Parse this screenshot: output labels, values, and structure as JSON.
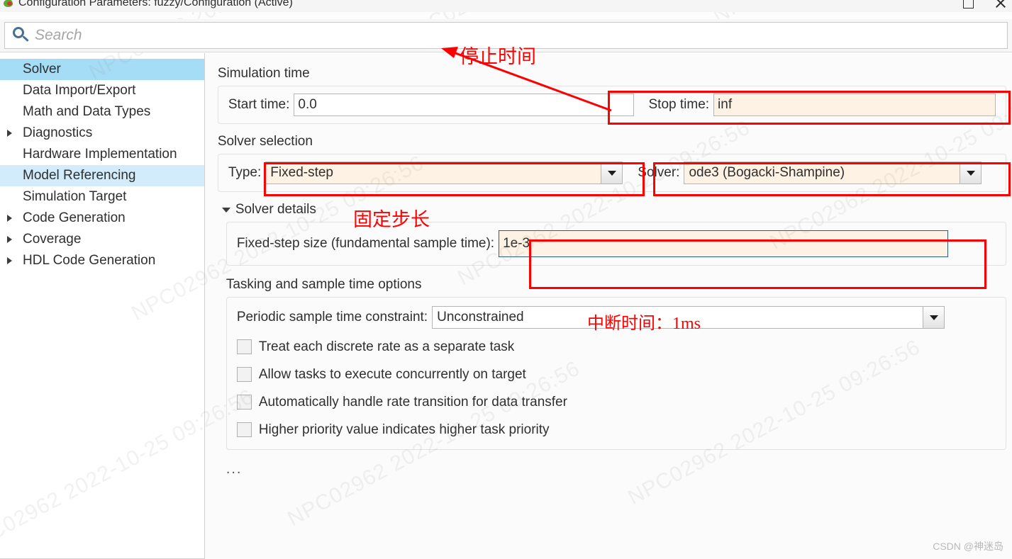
{
  "window": {
    "title": "Configuration Parameters: fuzzy/Configuration (Active)",
    "icon": "simulink-leaf-icon",
    "controls": {
      "maximize": "Maximize",
      "close": "Close"
    }
  },
  "search": {
    "placeholder": "Search",
    "value": "",
    "icon": "search-icon"
  },
  "sidebar": {
    "items": [
      {
        "label": "Solver",
        "expandable": false,
        "state": "selected"
      },
      {
        "label": "Data Import/Export",
        "expandable": false,
        "state": "normal"
      },
      {
        "label": "Math and Data Types",
        "expandable": false,
        "state": "normal"
      },
      {
        "label": "Diagnostics",
        "expandable": true,
        "state": "normal"
      },
      {
        "label": "Hardware Implementation",
        "expandable": false,
        "state": "normal"
      },
      {
        "label": "Model Referencing",
        "expandable": false,
        "state": "hovered"
      },
      {
        "label": "Simulation Target",
        "expandable": false,
        "state": "normal"
      },
      {
        "label": "Code Generation",
        "expandable": true,
        "state": "normal"
      },
      {
        "label": "Coverage",
        "expandable": true,
        "state": "normal"
      },
      {
        "label": "HDL Code Generation",
        "expandable": true,
        "state": "normal"
      }
    ]
  },
  "main": {
    "simulation_time": {
      "group_label": "Simulation time",
      "start_time_label": "Start time:",
      "start_time_value": "0.0",
      "stop_time_label": "Stop time:",
      "stop_time_value": "inf"
    },
    "solver_selection": {
      "group_label": "Solver selection",
      "type_label": "Type:",
      "type_value": "Fixed-step",
      "solver_label": "Solver:",
      "solver_value": "ode3 (Bogacki-Shampine)"
    },
    "solver_details": {
      "header_label": "Solver details",
      "fixed_step_label": "Fixed-step size (fundamental sample time):",
      "fixed_step_value": "1e-3"
    },
    "tasking": {
      "group_label": "Tasking and sample time options",
      "constraint_label": "Periodic sample time constraint:",
      "constraint_value": "Unconstrained",
      "checkboxes": [
        {
          "label": "Treat each discrete rate as a separate task",
          "checked": false
        },
        {
          "label": "Allow tasks to execute concurrently on target",
          "checked": false
        },
        {
          "label": "Automatically handle rate transition for data transfer",
          "checked": false
        },
        {
          "label": "Higher priority value indicates higher task priority",
          "checked": false
        }
      ]
    },
    "overflow_indicator": "..."
  },
  "annotations": {
    "stop_time": "停止时间",
    "fixed_step": "固定步长",
    "interrupt_time": "中断时间：1ms",
    "color": "#ff0000"
  },
  "watermarks": {
    "tile_text": "NPC02962 2022-10-25 09:26:56",
    "footer": "CSDN @神迷岛"
  }
}
